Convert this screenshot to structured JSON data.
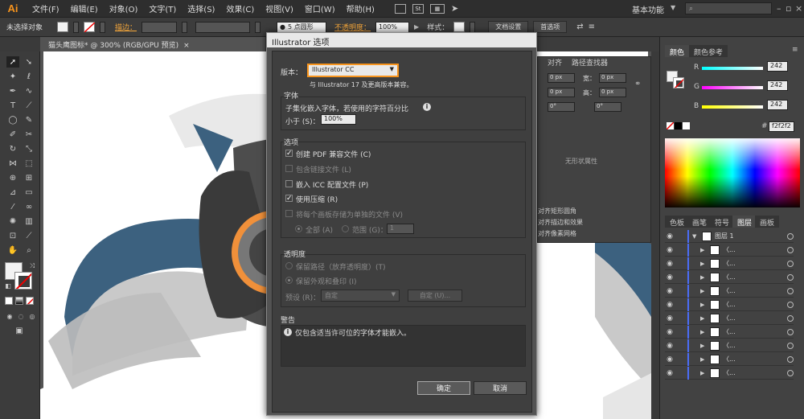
{
  "app": {
    "logo": "Ai"
  },
  "menu": [
    "文件(F)",
    "编辑(E)",
    "对象(O)",
    "文字(T)",
    "选择(S)",
    "效果(C)",
    "视图(V)",
    "窗口(W)",
    "帮助(H)"
  ],
  "menubar": {
    "box_label": "St",
    "workspace": "基本功能",
    "search_icon": "search-icon"
  },
  "control": {
    "selection": "未选择对象",
    "stroke_label": "描边：",
    "brush": "5 点圆形",
    "opacity_label": "不透明度：",
    "opacity_value": "100%",
    "style_label": "样式：",
    "doc_setup": "文档设置",
    "prefs": "首选项"
  },
  "document": {
    "tab": "猫头鹰图标* @ 300% (RGB/GPU 预览)"
  },
  "color_panel": {
    "tabs": [
      "颜色",
      "颜色参考"
    ],
    "r": {
      "label": "R",
      "value": "242",
      "level": 0.949
    },
    "g": {
      "label": "G",
      "value": "242",
      "level": 0.949
    },
    "b": {
      "label": "B",
      "value": "242",
      "level": 0.949
    },
    "hex": "f2f2f2",
    "fill_color": "#f2f2f2"
  },
  "layers_panel": {
    "tabs": [
      "色板",
      "画笔",
      "符号",
      "图层",
      "画板"
    ],
    "top_layer": "图层 1",
    "sublayer_name": "〈...",
    "rows": 10
  },
  "mid_panel": {
    "tabs": [
      "对齐",
      "路径查找器"
    ],
    "w_label": "宽：",
    "h_label": "高：",
    "field_px": "0 px",
    "field_deg": "0°",
    "no_shape": "无形状属性",
    "menu_items": [
      "对齐矩形圆角",
      "对齐描边和效果",
      "对齐像素网格"
    ]
  },
  "dialog": {
    "title": "Illustrator 选项",
    "version_label": "版本：",
    "version_value": "Illustrator CC",
    "compat_note": "与 Illustrator 17 及更高版本兼容。",
    "fonts": {
      "title": "字体",
      "subset_text": "子集化嵌入字体，若使用的字符百分比",
      "less_than": "小于 (S)：",
      "percent": "100%"
    },
    "options": {
      "title": "选项",
      "create_pdf": "创建 PDF 兼容文件 (C)",
      "include_linked": "包含链接文件 (L)",
      "embed_icc": "嵌入 ICC 配置文件 (P)",
      "use_compression": "使用压缩 (R)",
      "save_each_artboard": "将每个画板存储为单独的文件 (V)",
      "all": "全部 (A)",
      "range": "范围 (G)：",
      "range_value": "1"
    },
    "transparency": {
      "title": "透明度",
      "preserve_paths": "保留路径（放弃透明度）(T)",
      "preserve_appearance": "保留外观和叠印 (I)",
      "preset_label": "预设 (R)：",
      "preset_value": "自定",
      "custom_btn": "自定 (U)..."
    },
    "warning": {
      "title": "警告",
      "text": "仅包含适当许可位的字体才能嵌入。"
    },
    "ok": "确定",
    "cancel": "取消"
  }
}
